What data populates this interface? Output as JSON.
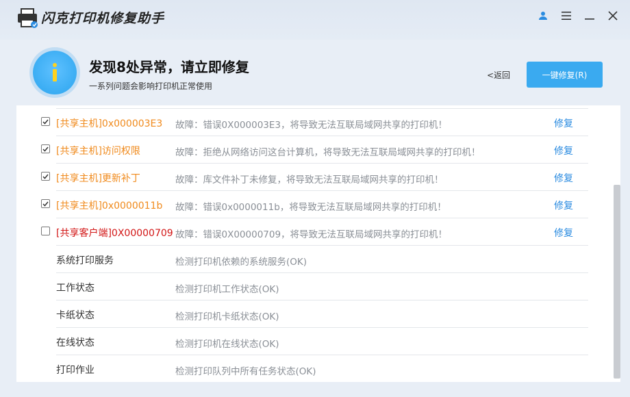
{
  "app": {
    "title": "闪克打印机修复助手"
  },
  "titlebar": {
    "user_icon": "user-icon",
    "menu_icon": "menu-icon",
    "minimize_icon": "minimize-icon",
    "close_icon": "close-icon"
  },
  "header": {
    "headline": "发现8处异常，请立即修复",
    "subline": "一系列问题会影响打印机正常使用",
    "back_label": "<返回",
    "fix_all_label": "一键修复(R)",
    "accent": "#3aaaf0"
  },
  "issues": [
    {
      "name": "[共享主机]0x000003E3",
      "desc": "故障：错误0X000003E3，将导致无法互联局域网共享的打印机！",
      "repair": "修复",
      "checked": true,
      "color": "orange"
    },
    {
      "name": "[共享主机]访问权限",
      "desc": "故障：拒绝从网络访问这台计算机，将导致无法互联局域网共享的打印机！",
      "repair": "修复",
      "checked": true,
      "color": "orange"
    },
    {
      "name": "[共享主机]更新补丁",
      "desc": "故障：库文件补丁未修复，将导致无法互联局域网共享的打印机！",
      "repair": "修复",
      "checked": true,
      "color": "orange"
    },
    {
      "name": "[共享主机]0x0000011b",
      "desc": "故障：错误0x0000011b，将导致无法互联局域网共享的打印机！",
      "repair": "修复",
      "checked": true,
      "color": "orange"
    },
    {
      "name": "[共享客户端]0X00000709",
      "desc": "故障：错误0X00000709，将导致无法互联局域网共享的打印机！",
      "repair": "修复",
      "checked": false,
      "color": "red"
    }
  ],
  "checks": [
    {
      "name": "系统打印服务",
      "desc": "检测打印机依赖的系统服务(OK)"
    },
    {
      "name": "工作状态",
      "desc": "检测打印机工作状态(OK)"
    },
    {
      "name": "卡纸状态",
      "desc": "检测打印机卡纸状态(OK)"
    },
    {
      "name": "在线状态",
      "desc": "检测打印机在线状态(OK)"
    },
    {
      "name": "打印作业",
      "desc": "检测打印队列中所有任务状态(OK)"
    }
  ]
}
